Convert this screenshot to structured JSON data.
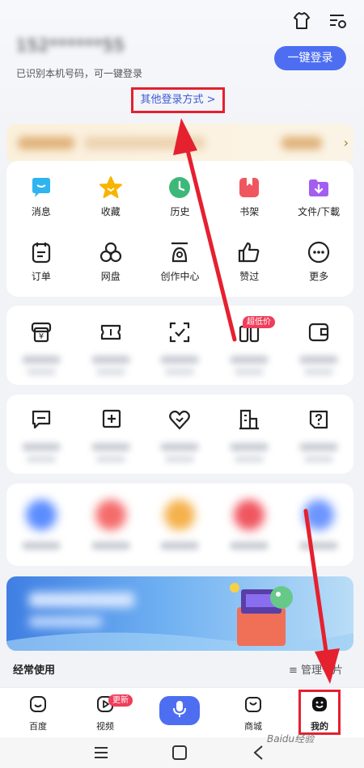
{
  "header": {
    "phone_masked": "152******55",
    "hint": "已识别本机号码，可一键登录",
    "login_button": "一键登录",
    "other_login": "其他登录方式 >"
  },
  "tools": [
    {
      "label": "消息",
      "icon": "message-icon"
    },
    {
      "label": "收藏",
      "icon": "star-icon"
    },
    {
      "label": "历史",
      "icon": "clock-icon"
    },
    {
      "label": "书架",
      "icon": "bookshelf-icon"
    },
    {
      "label": "文件/下載",
      "icon": "download-icon"
    },
    {
      "label": "订单",
      "icon": "order-icon"
    },
    {
      "label": "网盘",
      "icon": "cloud-disk-icon"
    },
    {
      "label": "创作中心",
      "icon": "creator-icon"
    },
    {
      "label": "赞过",
      "icon": "thumbs-up-icon"
    },
    {
      "label": "更多",
      "icon": "more-icon"
    }
  ],
  "services_badge": "超低价",
  "freq": {
    "title": "经常使用",
    "manage": "管理卡片"
  },
  "nav": {
    "items": [
      {
        "label": "百度",
        "icon": "home-icon"
      },
      {
        "label": "视频",
        "icon": "video-icon"
      },
      {
        "label": "",
        "icon": "mic-icon"
      },
      {
        "label": "商城",
        "icon": "mall-icon"
      },
      {
        "label": "我的",
        "icon": "profile-icon"
      }
    ],
    "video_badge": "更新"
  },
  "watermark": "Baidu经验",
  "colors": {
    "accent": "#4e6ef2",
    "annotation": "#e5202f",
    "badge": "#ef3d5a"
  }
}
